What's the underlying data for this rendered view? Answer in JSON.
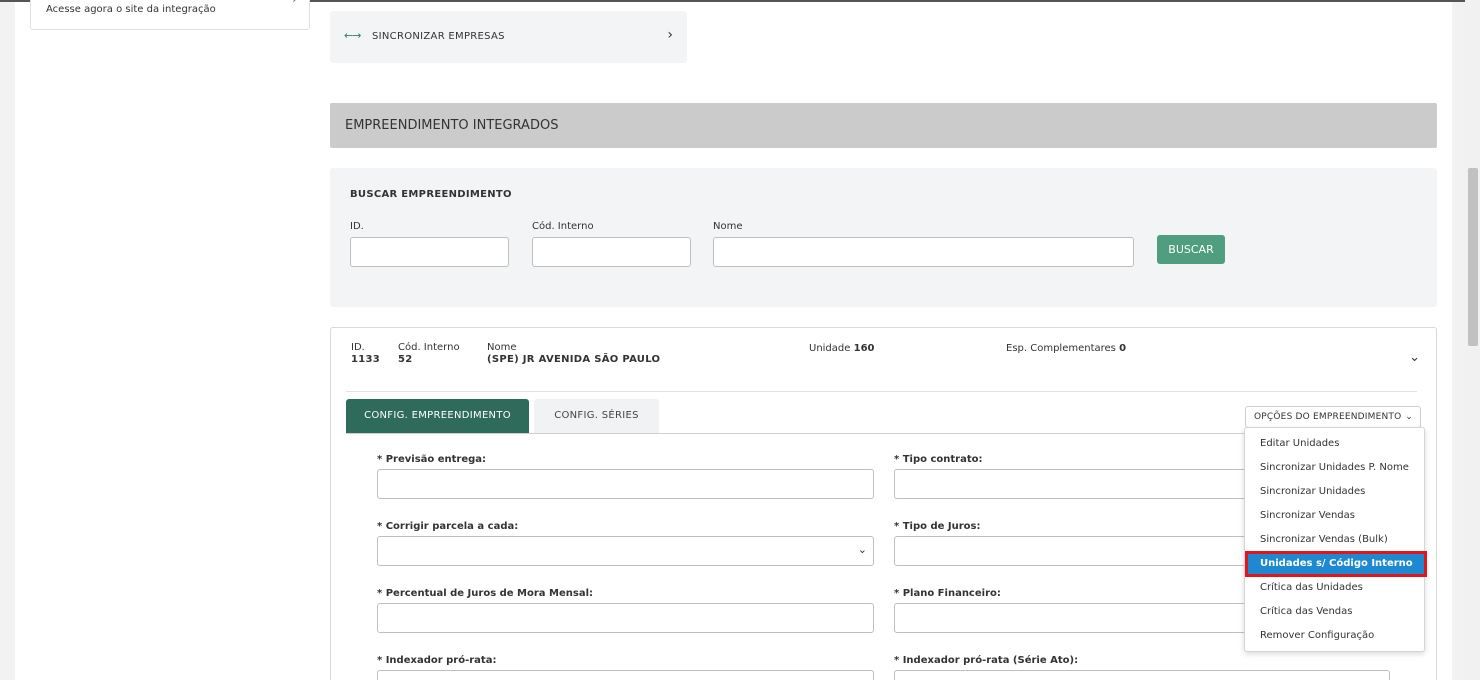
{
  "left_card": {
    "text": "Acesse agora o site da integração"
  },
  "sync": {
    "label": "SINCRONIZAR EMPRESAS"
  },
  "section": {
    "title": "EMPREENDIMENTO INTEGRADOS"
  },
  "search": {
    "title": "BUSCAR EMPREENDIMENTO",
    "fields": [
      {
        "label": "ID.",
        "value": ""
      },
      {
        "label": "Cód. Interno",
        "value": ""
      },
      {
        "label": "Nome",
        "value": ""
      }
    ],
    "button": "BUSCAR"
  },
  "result": {
    "id_label": "ID.",
    "id_value": "1133",
    "code_label": "Cód. Interno",
    "code_value": "52",
    "name_label": "Nome",
    "name_value": "(SPE) JR AVENIDA SÃO PAULO",
    "unit_label": "Unidade",
    "unit_value": "160",
    "esp_label": "Esp. Complementares",
    "esp_value": "0"
  },
  "tabs": [
    {
      "label": "CONFIG. EMPREENDIMENTO",
      "active": true
    },
    {
      "label": "CONFIG. SÉRIES",
      "active": false
    }
  ],
  "options_button": "OPÇÕES DO EMPREENDIMENTO",
  "form": {
    "fields": [
      {
        "label": "* Previsão entrega:",
        "value": ""
      },
      {
        "label": "* Tipo contrato:",
        "value": ""
      },
      {
        "label": "* Corrigir parcela a cada:",
        "value": ""
      },
      {
        "label": "* Tipo de Juros:",
        "value": ""
      },
      {
        "label": "* Percentual de Juros de Mora Mensal:",
        "value": ""
      },
      {
        "label": "* Plano Financeiro:",
        "value": ""
      },
      {
        "label": "* Indexador pró-rata:",
        "value": ""
      },
      {
        "label": "* Indexador pró-rata (Série Ato):",
        "value": ""
      }
    ]
  },
  "menu": {
    "items": [
      "Editar Unidades",
      "Sincronizar Unidades P. Nome",
      "Sincronizar Unidades",
      "Sincronizar Vendas",
      "Sincronizar Vendas (Bulk)",
      "Unidades s/ Código Interno",
      "Crítica das Unidades",
      "Crítica das Vendas",
      "Remover Configuração"
    ],
    "selected": "Unidades s/ Código Interno"
  },
  "colors": {
    "accent_green": "#2f6b5b",
    "button_green": "#4f9e7f",
    "selected_blue": "#1e88d0",
    "highlight_red": "#e4141b"
  }
}
